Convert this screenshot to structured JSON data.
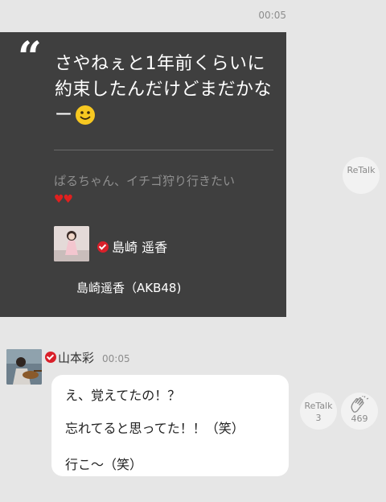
{
  "top_time": "00:05",
  "quote": {
    "text": "さやねぇと1年前くらいに約束したんだけどまだかなー",
    "emoji_icon": "smiley-emoji-icon",
    "reply": "ぱるちゃん、イチゴ狩り行きたい",
    "hearts": "♥♥",
    "author_name": "島崎 遥香",
    "source": "島崎遥香（AKB48)"
  },
  "retalk_top": {
    "label": "ReTalk"
  },
  "message": {
    "user": "山本彩",
    "time": "00:05",
    "lines": [
      "え、覚えてたの！？",
      "忘れてると思ってた！！（笑）",
      "行こ〜（笑）"
    ]
  },
  "retalk_bottom": {
    "label": "ReTalk",
    "count": "3"
  },
  "clap": {
    "count": "469",
    "icon": "clap-icon"
  },
  "colors": {
    "background": "#e6e6e6",
    "card": "#3f3f3f",
    "verified": "#d9202a",
    "hearts": "#e0201f"
  }
}
